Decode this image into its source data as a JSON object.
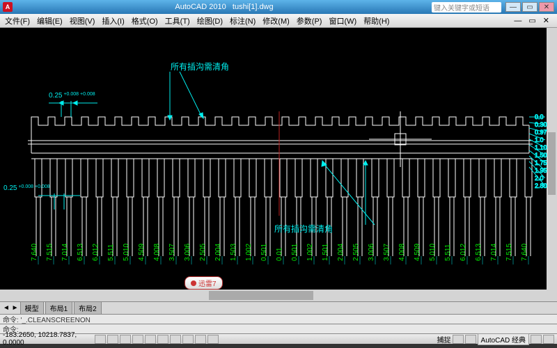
{
  "title": {
    "app": "AutoCAD 2010",
    "file": "tushi[1].dwg",
    "search_placeholder": "键入关键字或短语",
    "logo": "A"
  },
  "menu": {
    "items": [
      "文件(F)",
      "编辑(E)",
      "视图(V)",
      "插入(I)",
      "格式(O)",
      "工具(T)",
      "绘图(D)",
      "标注(N)",
      "修改(M)",
      "参数(P)",
      "窗口(W)",
      "帮助(H)"
    ]
  },
  "annotation": {
    "top": "所有插沟需清角",
    "bot": "所有插沟需清角",
    "dim_top": "0.25",
    "dim_top_tol": "+0.008\n+0.008",
    "dim_left": "0.25",
    "dim_left_tol": "+0.008\n+0.008"
  },
  "right_dims": [
    "0.0",
    "0.30",
    "0.97",
    "1.0",
    "1.10",
    "1.50",
    "1.75",
    "1.95",
    "2.0",
    "2.80"
  ],
  "vertical_dims": [
    "7.640",
    "7.515",
    "7.014",
    "6.513",
    "6.012",
    "5.511",
    "5.010",
    "4.509",
    "4.008",
    "3.507",
    "3.006",
    "2.505",
    "2.004",
    "1.503",
    "1.002",
    "0.501",
    "0.01",
    "0.501",
    "1.002",
    "1.501",
    "2.004",
    "2.505",
    "3.006",
    "3.507",
    "4.008",
    "4.509",
    "5.010",
    "5.511",
    "6.012",
    "6.513",
    "7.014",
    "7.515",
    "7.640"
  ],
  "layout": {
    "nav": "◄ ►",
    "tabs": [
      "模型",
      "布局1",
      "布局2"
    ]
  },
  "cmd": {
    "line1": "命令: '_.CLEANSCREENON",
    "line2": "命令:"
  },
  "status": {
    "coord": "-183.2650, 10218.7837, 0.0000",
    "snap": "捕捉",
    "layout_combo": "AutoCAD 经典"
  },
  "popup": {
    "text": "迅雷7"
  },
  "chart_data": null
}
